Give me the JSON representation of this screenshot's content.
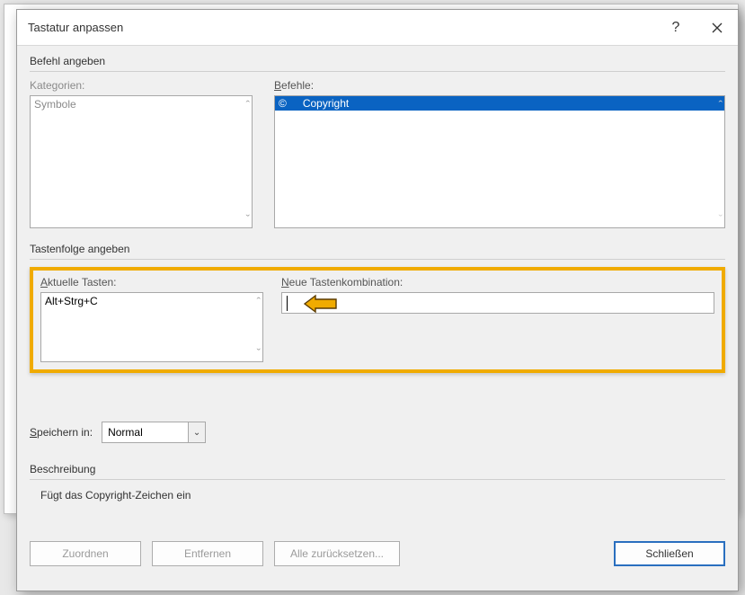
{
  "dialog": {
    "title": "Tastatur anpassen"
  },
  "section_command": {
    "label": "Befehl angeben",
    "categories_label": "Kategorien:",
    "categories_item": "Symbole",
    "commands_label": "Befehle:",
    "command_symbol": "©",
    "command_name": "Copyright"
  },
  "section_keys": {
    "label": "Tastenfolge angeben",
    "current_label": "Aktuelle Tasten:",
    "current_value": "Alt+Strg+C",
    "new_label": "Neue Tastenkombination:"
  },
  "save_in": {
    "label_prefix": "S",
    "label_rest": "peichern in:",
    "value": "Normal"
  },
  "description": {
    "label": "Beschreibung",
    "text": "Fügt das Copyright-Zeichen ein"
  },
  "buttons": {
    "assign": "Zuordnen",
    "remove": "Entfernen",
    "reset": "Alle zurücksetzen...",
    "close": "Schließen"
  }
}
